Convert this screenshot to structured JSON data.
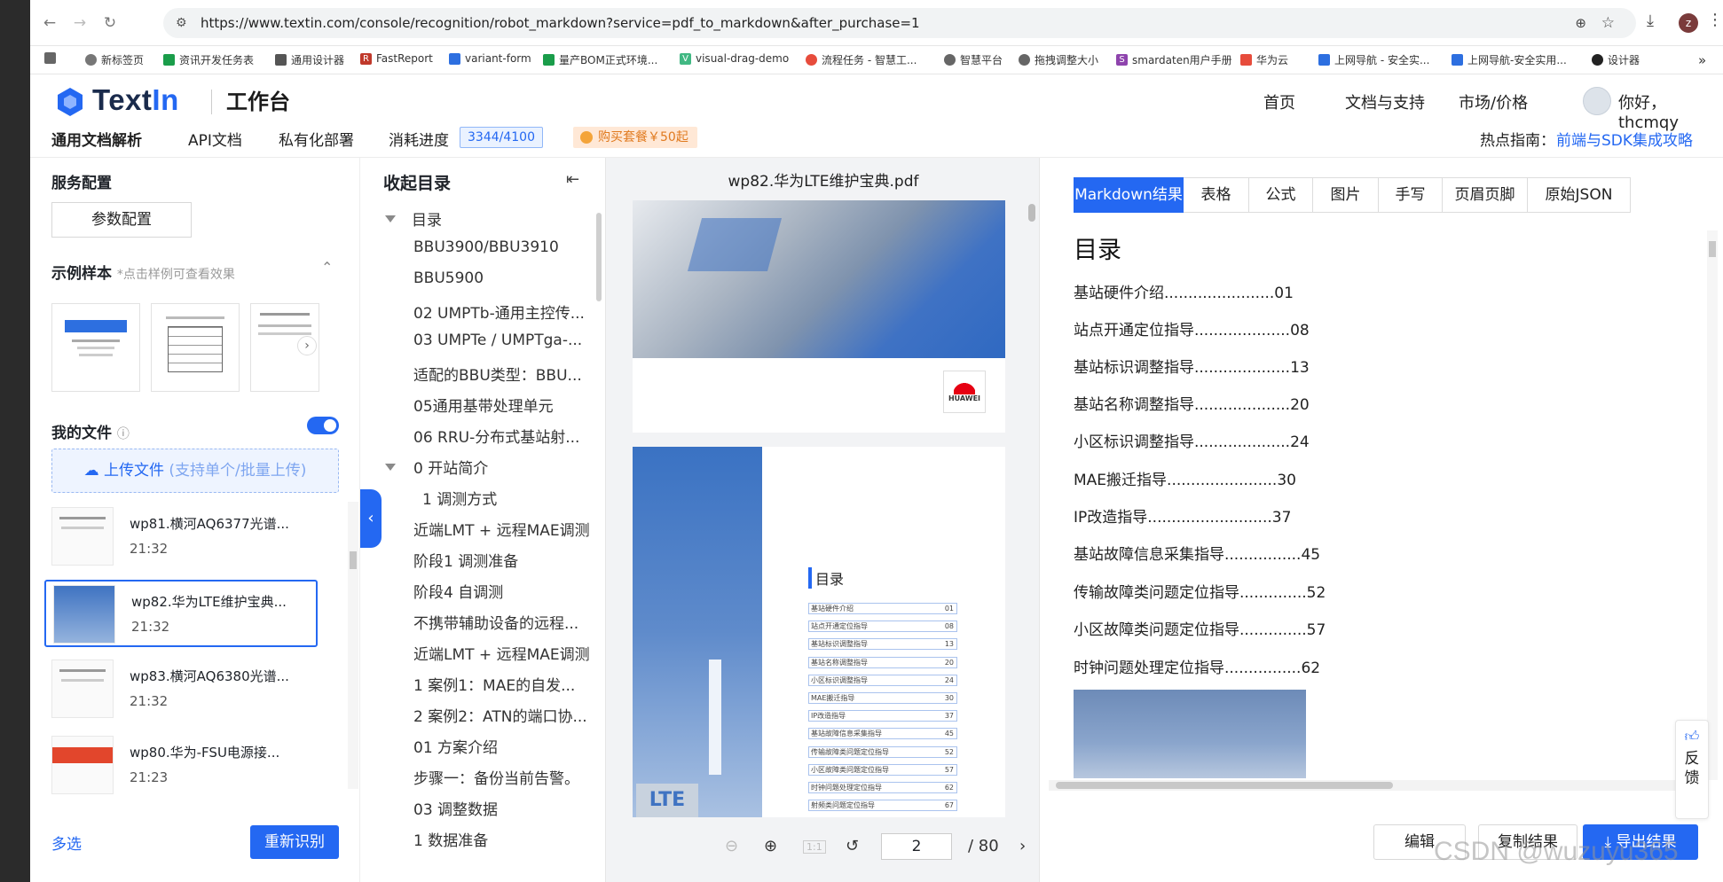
{
  "browser": {
    "url": "https://www.textin.com/console/recognition/robot_markdown?service=pdf_to_markdown&after_purchase=1",
    "profile_initial": "z",
    "bookmarks": [
      "新标签页",
      "资讯开发任务表",
      "通用设计器",
      "FastReport",
      "variant-form",
      "量产BOM正式环境...",
      "visual-drag-demo",
      "流程任务 - 智慧工...",
      "智慧平台",
      "拖拽调整大小",
      "smardaten用户手册",
      "华为云",
      "上网导航 - 安全实...",
      "上网导航-安全实用...",
      "设计器"
    ]
  },
  "header": {
    "logo_text_a": "Text",
    "logo_text_b": "In",
    "workspace": "工作台",
    "nav": [
      "首页",
      "文档与支持",
      "市场/价格"
    ],
    "greeting": "你好，thcmqy",
    "subnav": [
      "通用文档解析",
      "API文档",
      "私有化部署",
      "消耗进度"
    ],
    "usage": "3344/4100",
    "buy": "购买套餐￥50起",
    "hot_label": "热点指南：",
    "hot_link": "前端与SDK集成攻略"
  },
  "left": {
    "service_config": "服务配置",
    "param_config": "参数配置",
    "samples_title": "示例样本",
    "samples_hint": "*点击样例可查看效果",
    "my_files": "我的文件",
    "upload_label": "上传文件",
    "upload_hint": "(支持单个/批量上传)",
    "files": [
      {
        "name": "wp81.横河AQ6377光谱...",
        "time": "21:32"
      },
      {
        "name": "wp82.华为LTE维护宝典...",
        "time": "21:32"
      },
      {
        "name": "wp83.横河AQ6380光谱...",
        "time": "21:32"
      },
      {
        "name": "wp80.华为-FSU电源接...",
        "time": "21:23"
      }
    ],
    "multi_select": "多选",
    "re_recognize": "重新识别"
  },
  "toc": {
    "title": "收起目录",
    "items": [
      "目录",
      "BBU3900/BBU3910",
      "BBU5900",
      "02 UMPTb-通用主控传...",
      "03 UMPTe / UMPTga-...",
      "适配的BBU类型：BBU...",
      "05通用基带处理单元",
      "06 RRU-分布式基站射...",
      "0 开站简介",
      "1 调测方式",
      "近端LMT + 远程MAE调测",
      "阶段1 调测准备",
      "阶段4 自调测",
      "不携带辅助设备的远程...",
      "近端LMT + 远程MAE调测",
      "1 案例1：MAE的自发...",
      "2 案例2：ATN的端口协...",
      "01 方案介绍",
      "步骤一：备份当前告警。",
      "03 调整数据",
      "1 数据准备"
    ]
  },
  "pdf": {
    "title": "wp82.华为LTE维护宝典.pdf",
    "brand": "HUAWEI",
    "toc_heading": "目录",
    "toc_rows": [
      {
        "t": "基站硬件介绍",
        "p": "01"
      },
      {
        "t": "站点开通定位指导",
        "p": "08"
      },
      {
        "t": "基站标识调整指导",
        "p": "13"
      },
      {
        "t": "基站名称调整指导",
        "p": "20"
      },
      {
        "t": "小区标识调整指导",
        "p": "24"
      },
      {
        "t": "MAE搬迁指导",
        "p": "30"
      },
      {
        "t": "IP改造指导",
        "p": "37"
      },
      {
        "t": "基站故障信息采集指导",
        "p": "45"
      },
      {
        "t": "传输故障类问题定位指导",
        "p": "52"
      },
      {
        "t": "小区故障类问题定位指导",
        "p": "57"
      },
      {
        "t": "时钟问题处理定位指导",
        "p": "62"
      },
      {
        "t": "射频类问题定位指导",
        "p": "67"
      }
    ],
    "page": "2",
    "total": "/ 80",
    "cover_text": "LTE"
  },
  "result": {
    "tabs": [
      "Markdown结果",
      "表格",
      "公式",
      "图片",
      "手写",
      "页眉页脚",
      "原始JSON"
    ],
    "heading": "目录",
    "lines": [
      "基站硬件介绍.......................01",
      "站点开通定位指导....................08",
      "基站标识调整指导....................13",
      "基站名称调整指导....................20",
      "小区标识调整指导....................24",
      "MAE搬迁指导.......................30",
      "IP改造指导..........................37",
      "基站故障信息采集指导................45",
      "传输故障类问题定位指导..............52",
      "小区故障类问题定位指导..............57",
      "时钟问题处理定位指导................62"
    ],
    "feedback": "反馈",
    "edit": "编辑",
    "copy": "复制结果",
    "export": "导出结果"
  },
  "watermark": "CSDN @wuzuyu365",
  "colors": {
    "accent": "#2468f2",
    "buy": "#e07a1f"
  }
}
